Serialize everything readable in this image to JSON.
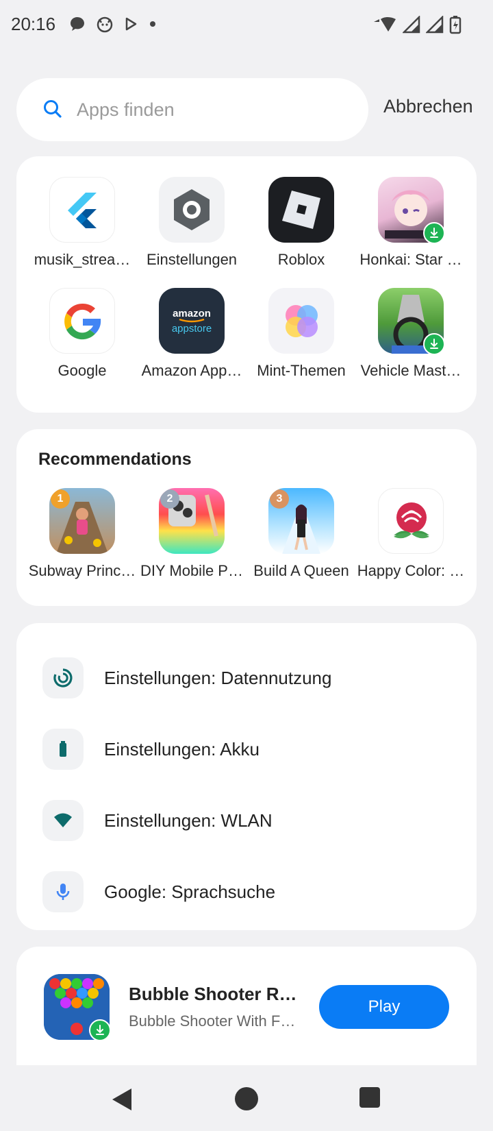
{
  "status_bar": {
    "time": "20:16",
    "left_icons": [
      "chat-bubble-icon",
      "cat-face-icon",
      "play-store-icon",
      "dot-icon"
    ],
    "right_icons": [
      "wifi-icon",
      "signal-icon",
      "signal-icon",
      "battery-charging-icon"
    ]
  },
  "search": {
    "placeholder": "Apps finden",
    "value": "",
    "cancel_label": "Abbrechen"
  },
  "apps": [
    {
      "label": "musik_strea…",
      "icon": "flutter-icon",
      "download": false
    },
    {
      "label": "Einstellungen",
      "icon": "settings-gear-icon",
      "download": false
    },
    {
      "label": "Roblox",
      "icon": "roblox-icon",
      "download": false
    },
    {
      "label": "Honkai: Star …",
      "icon": "honkai-icon",
      "download": true
    },
    {
      "label": "Google",
      "icon": "google-g-icon",
      "download": false
    },
    {
      "label": "Amazon App…",
      "icon": "amazon-appstore-icon",
      "download": false
    },
    {
      "label": "Mint-Themen",
      "icon": "mint-themes-icon",
      "download": false
    },
    {
      "label": "Vehicle Mast…",
      "icon": "vehicle-master-icon",
      "download": true
    }
  ],
  "recommendations": {
    "title": "Recommendations",
    "items": [
      {
        "label": "Subway Princ…",
        "rank": "1",
        "icon": "subway-princess-icon"
      },
      {
        "label": "DIY Mobile P…",
        "rank": "2",
        "icon": "diy-mobile-icon"
      },
      {
        "label": "Build A Queen",
        "rank": "3",
        "icon": "build-a-queen-icon"
      },
      {
        "label": "Happy Color: …",
        "rank": "",
        "icon": "happy-color-icon"
      }
    ]
  },
  "shortcuts": [
    {
      "label": "Einstellungen: Datennutzung",
      "icon": "data-usage-icon"
    },
    {
      "label": "Einstellungen: Akku",
      "icon": "battery-icon"
    },
    {
      "label": "Einstellungen: WLAN",
      "icon": "wifi-icon"
    },
    {
      "label": "Google: Sprachsuche",
      "icon": "microphone-icon"
    }
  ],
  "promo": {
    "title": "Bubble Shooter R…",
    "subtitle": "Bubble Shooter With F…",
    "button_label": "Play",
    "icon": "bubble-shooter-icon"
  },
  "colors": {
    "accent": "#0a7cf5",
    "download_badge": "#1db454",
    "settings_teal": "#0d6b6b",
    "background": "#f1f1f3"
  }
}
